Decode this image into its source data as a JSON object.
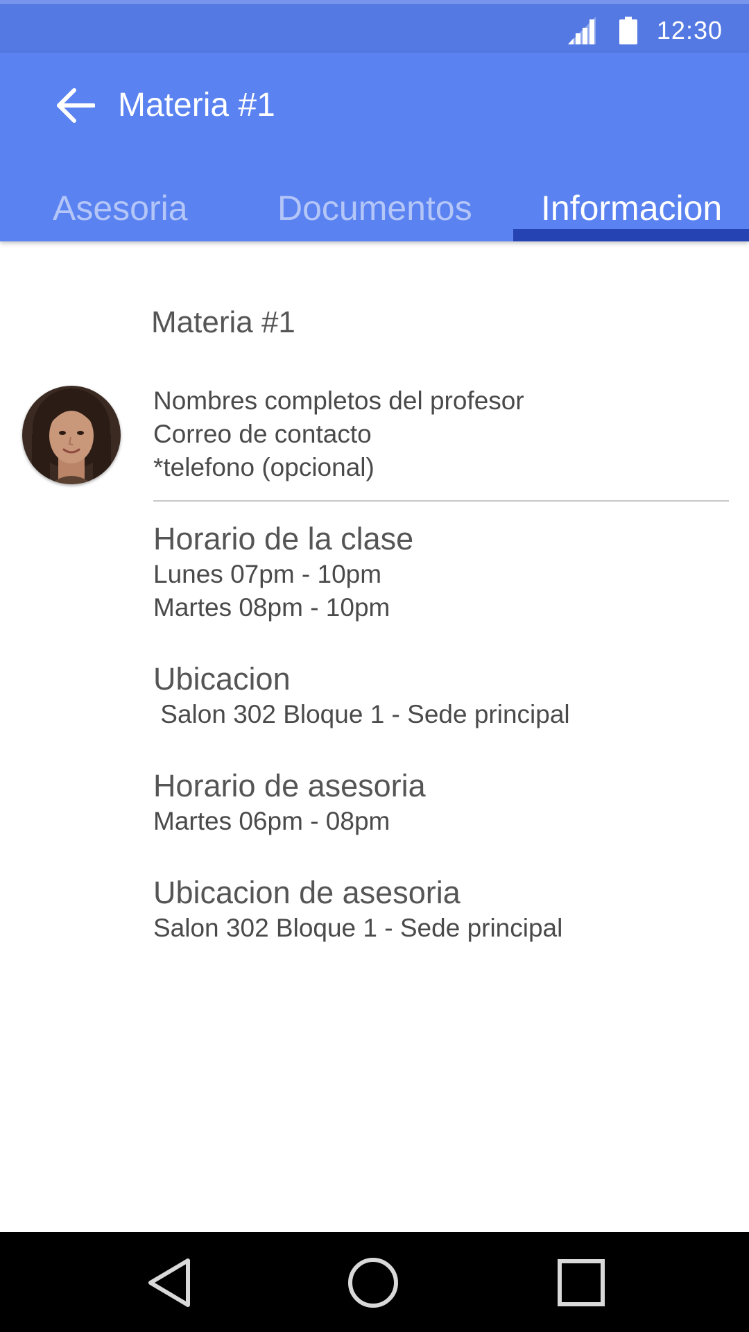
{
  "status_bar": {
    "time": "12:30",
    "icons": [
      "signal-icon",
      "battery-icon"
    ]
  },
  "app_bar": {
    "title": "Materia #1",
    "back_icon": "arrow-back-icon",
    "tabs": [
      {
        "label": "Asesoria",
        "active": false
      },
      {
        "label": "Documentos",
        "active": false
      },
      {
        "label": "Informacion",
        "active": true
      }
    ]
  },
  "content": {
    "title": "Materia #1",
    "professor": {
      "name": "Nombres completos del profesor",
      "email": "Correo de contacto",
      "phone": "*telefono (opcional)"
    },
    "sections": [
      {
        "title": "Horario de la clase",
        "lines": [
          "Lunes 07pm - 10pm",
          "Martes 08pm - 10pm"
        ]
      },
      {
        "title": "Ubicacion",
        "lines": [
          " Salon 302 Bloque 1 - Sede principal"
        ]
      },
      {
        "title": "Horario de asesoria",
        "lines": [
          "Martes 06pm - 08pm"
        ]
      },
      {
        "title": "Ubicacion de asesoria",
        "lines": [
          "Salon 302 Bloque 1 - Sede principal"
        ]
      }
    ]
  },
  "nav_bar": {
    "buttons": [
      "nav-back-icon",
      "nav-home-icon",
      "nav-recents-icon"
    ]
  },
  "colors": {
    "status_bar": "#5479e3",
    "app_bar": "#5a82f0",
    "tab_indicator": "#2643b4",
    "nav_bar": "#000000"
  }
}
